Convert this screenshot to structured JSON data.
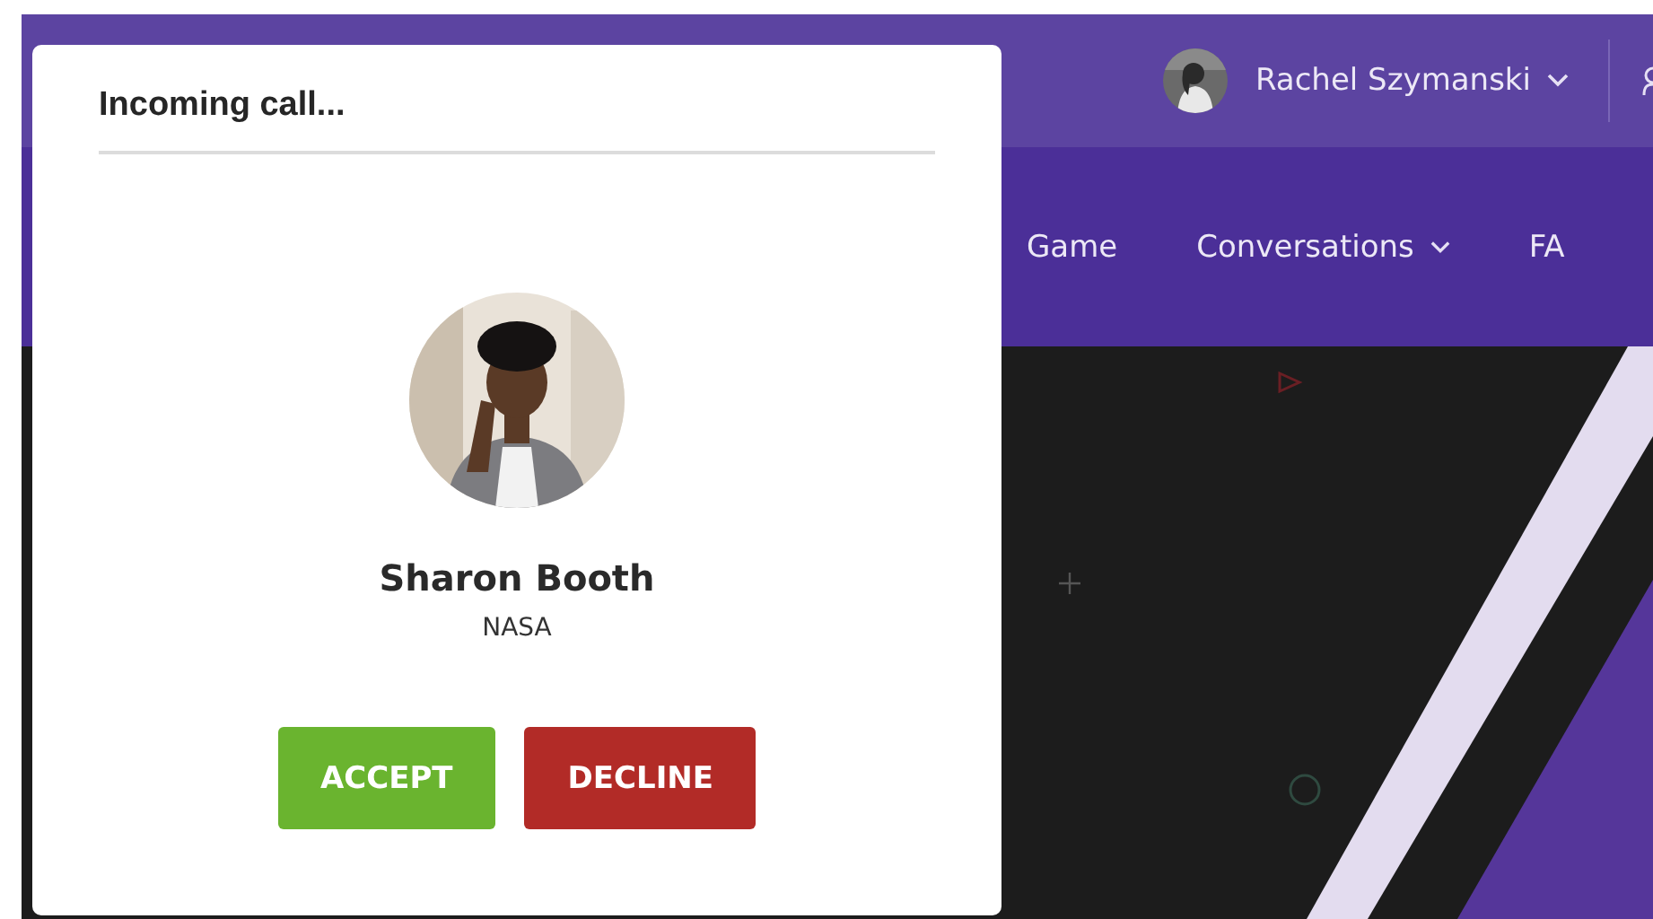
{
  "top_bar": {
    "user_name": "Rachel Szymanski",
    "user_menu_expanded": false
  },
  "nav": {
    "items": [
      {
        "label": "Game",
        "dropdown": false
      },
      {
        "label": "Conversations",
        "dropdown": true
      },
      {
        "label": "FA",
        "dropdown": false
      }
    ]
  },
  "call_dialog": {
    "title": "Incoming call...",
    "caller_name": "Sharon Booth",
    "caller_org": "NASA",
    "buttons": [
      {
        "label": "ACCEPT",
        "kind": "accept"
      },
      {
        "label": "DECLINE",
        "kind": "decline"
      }
    ]
  }
}
